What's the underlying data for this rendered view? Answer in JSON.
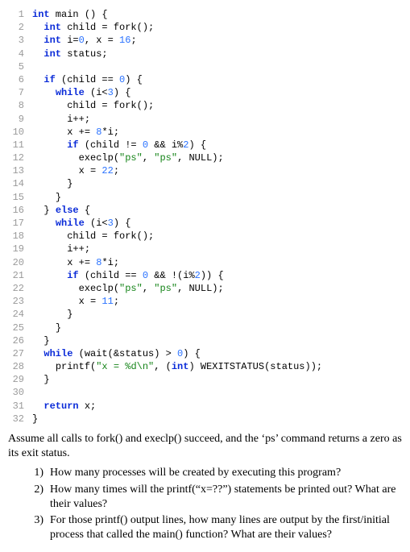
{
  "code": {
    "lines": [
      {
        "n": "1",
        "indent": "",
        "tokens": [
          [
            "kw",
            "int"
          ],
          [
            "plain",
            " main () {"
          ]
        ]
      },
      {
        "n": "2",
        "indent": "  ",
        "tokens": [
          [
            "kw",
            "int"
          ],
          [
            "plain",
            " child = fork();"
          ]
        ]
      },
      {
        "n": "3",
        "indent": "  ",
        "tokens": [
          [
            "kw",
            "int"
          ],
          [
            "plain",
            " i="
          ],
          [
            "num",
            "0"
          ],
          [
            "plain",
            ", x = "
          ],
          [
            "num",
            "16"
          ],
          [
            "plain",
            ";"
          ]
        ]
      },
      {
        "n": "4",
        "indent": "  ",
        "tokens": [
          [
            "kw",
            "int"
          ],
          [
            "plain",
            " status;"
          ]
        ]
      },
      {
        "n": "5",
        "indent": "",
        "tokens": []
      },
      {
        "n": "6",
        "indent": "  ",
        "tokens": [
          [
            "kw",
            "if"
          ],
          [
            "plain",
            " (child == "
          ],
          [
            "num",
            "0"
          ],
          [
            "plain",
            ") {"
          ]
        ]
      },
      {
        "n": "7",
        "indent": "    ",
        "tokens": [
          [
            "kw",
            "while"
          ],
          [
            "plain",
            " (i<"
          ],
          [
            "num",
            "3"
          ],
          [
            "plain",
            ") {"
          ]
        ]
      },
      {
        "n": "8",
        "indent": "      ",
        "tokens": [
          [
            "plain",
            "child = fork();"
          ]
        ]
      },
      {
        "n": "9",
        "indent": "      ",
        "tokens": [
          [
            "plain",
            "i++;"
          ]
        ]
      },
      {
        "n": "10",
        "indent": "      ",
        "tokens": [
          [
            "plain",
            "x += "
          ],
          [
            "num",
            "8"
          ],
          [
            "plain",
            "*i;"
          ]
        ]
      },
      {
        "n": "11",
        "indent": "      ",
        "tokens": [
          [
            "kw",
            "if"
          ],
          [
            "plain",
            " (child != "
          ],
          [
            "num",
            "0"
          ],
          [
            "plain",
            " && i%"
          ],
          [
            "num",
            "2"
          ],
          [
            "plain",
            ") {"
          ]
        ]
      },
      {
        "n": "12",
        "indent": "        ",
        "tokens": [
          [
            "plain",
            "execlp("
          ],
          [
            "str",
            "\"ps\""
          ],
          [
            "plain",
            ", "
          ],
          [
            "str",
            "\"ps\""
          ],
          [
            "plain",
            ", NULL);"
          ]
        ]
      },
      {
        "n": "13",
        "indent": "        ",
        "tokens": [
          [
            "plain",
            "x = "
          ],
          [
            "num",
            "22"
          ],
          [
            "plain",
            ";"
          ]
        ]
      },
      {
        "n": "14",
        "indent": "      ",
        "tokens": [
          [
            "plain",
            "}"
          ]
        ]
      },
      {
        "n": "15",
        "indent": "    ",
        "tokens": [
          [
            "plain",
            "}"
          ]
        ]
      },
      {
        "n": "16",
        "indent": "  ",
        "tokens": [
          [
            "plain",
            "} "
          ],
          [
            "kw",
            "else"
          ],
          [
            "plain",
            " {"
          ]
        ]
      },
      {
        "n": "17",
        "indent": "    ",
        "tokens": [
          [
            "kw",
            "while"
          ],
          [
            "plain",
            " (i<"
          ],
          [
            "num",
            "3"
          ],
          [
            "plain",
            ") {"
          ]
        ]
      },
      {
        "n": "18",
        "indent": "      ",
        "tokens": [
          [
            "plain",
            "child = fork();"
          ]
        ]
      },
      {
        "n": "19",
        "indent": "      ",
        "tokens": [
          [
            "plain",
            "i++;"
          ]
        ]
      },
      {
        "n": "20",
        "indent": "      ",
        "tokens": [
          [
            "plain",
            "x += "
          ],
          [
            "num",
            "8"
          ],
          [
            "plain",
            "*i;"
          ]
        ]
      },
      {
        "n": "21",
        "indent": "      ",
        "tokens": [
          [
            "kw",
            "if"
          ],
          [
            "plain",
            " (child == "
          ],
          [
            "num",
            "0"
          ],
          [
            "plain",
            " && !(i%"
          ],
          [
            "num",
            "2"
          ],
          [
            "plain",
            ")) {"
          ]
        ]
      },
      {
        "n": "22",
        "indent": "        ",
        "tokens": [
          [
            "plain",
            "execlp("
          ],
          [
            "str",
            "\"ps\""
          ],
          [
            "plain",
            ", "
          ],
          [
            "str",
            "\"ps\""
          ],
          [
            "plain",
            ", NULL);"
          ]
        ]
      },
      {
        "n": "23",
        "indent": "        ",
        "tokens": [
          [
            "plain",
            "x = "
          ],
          [
            "num",
            "11"
          ],
          [
            "plain",
            ";"
          ]
        ]
      },
      {
        "n": "24",
        "indent": "      ",
        "tokens": [
          [
            "plain",
            "}"
          ]
        ]
      },
      {
        "n": "25",
        "indent": "    ",
        "tokens": [
          [
            "plain",
            "}"
          ]
        ]
      },
      {
        "n": "26",
        "indent": "  ",
        "tokens": [
          [
            "plain",
            "}"
          ]
        ]
      },
      {
        "n": "27",
        "indent": "  ",
        "tokens": [
          [
            "kw",
            "while"
          ],
          [
            "plain",
            " (wait(&status) > "
          ],
          [
            "num",
            "0"
          ],
          [
            "plain",
            ") {"
          ]
        ]
      },
      {
        "n": "28",
        "indent": "    ",
        "tokens": [
          [
            "plain",
            "printf("
          ],
          [
            "str",
            "\"x = %d\\n\""
          ],
          [
            "plain",
            ", ("
          ],
          [
            "kw",
            "int"
          ],
          [
            "plain",
            ") WEXITSTATUS(status));"
          ]
        ]
      },
      {
        "n": "29",
        "indent": "  ",
        "tokens": [
          [
            "plain",
            "}"
          ]
        ]
      },
      {
        "n": "30",
        "indent": "",
        "tokens": []
      },
      {
        "n": "31",
        "indent": "  ",
        "tokens": [
          [
            "kw",
            "return"
          ],
          [
            "plain",
            " x;"
          ]
        ]
      },
      {
        "n": "32",
        "indent": "",
        "tokens": [
          [
            "plain",
            "}"
          ]
        ]
      }
    ]
  },
  "assume_text": "Assume all calls to fork() and execlp() succeed, and the ‘ps’ command returns a zero as its exit status.",
  "questions": [
    {
      "num": "1)",
      "text": "How many processes will be created by executing this program?"
    },
    {
      "num": "2)",
      "text": "How many times will the printf(“x=??”) statements be printed out? What are their values?"
    },
    {
      "num": "3)",
      "text": "For those printf() output lines, how many lines are output by the first/initial process that called the main() function? What are their values?"
    }
  ]
}
